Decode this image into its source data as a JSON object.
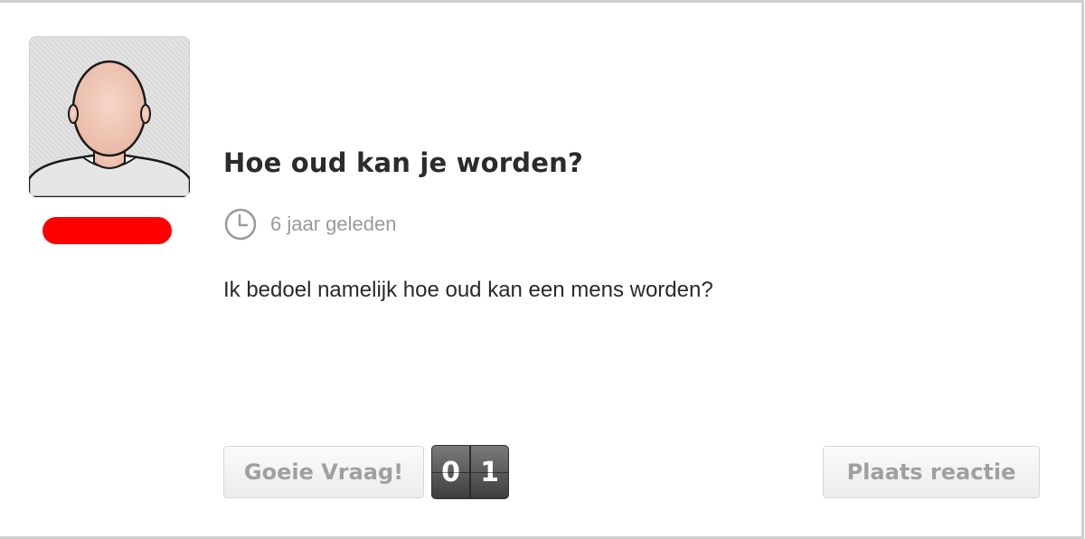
{
  "question": {
    "title": "Hoe oud kan je worden?",
    "time_ago": "6 jaar geleden",
    "body": "Ik bedoel namelijk hoe oud kan een mens worden?"
  },
  "user": {
    "avatar_icon": "default-avatar-icon",
    "name_redacted_color": "#ff0000"
  },
  "actions": {
    "good_question_label": "Goeie Vraag!",
    "vote_digits": [
      "0",
      "1"
    ],
    "reply_label": "Plaats reactie"
  },
  "icons": {
    "clock": "clock-icon"
  }
}
